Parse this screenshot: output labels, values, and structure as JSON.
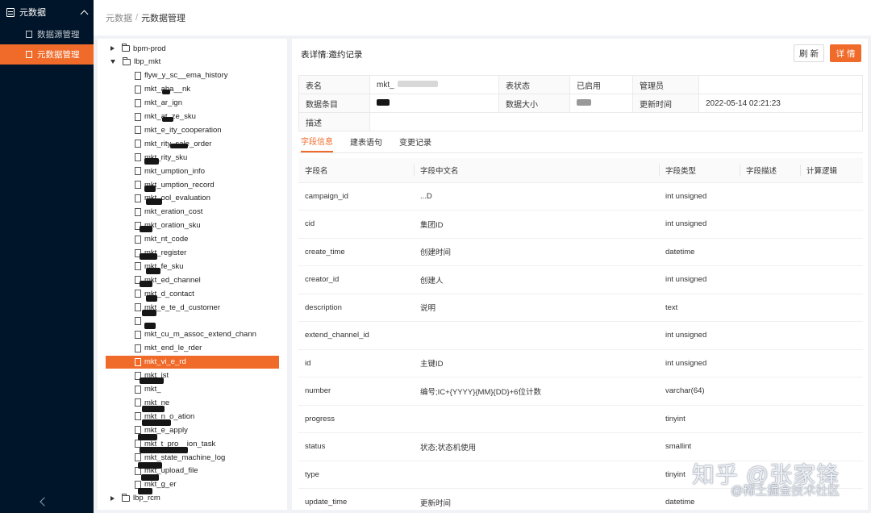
{
  "sidebar": {
    "group_label": "元数据",
    "items": [
      {
        "label": "数据源管理",
        "active": false
      },
      {
        "label": "元数据管理",
        "active": true
      }
    ]
  },
  "breadcrumb": {
    "parent": "元数据",
    "separator": "/",
    "current": "元数据管理"
  },
  "tree": {
    "nodes": [
      {
        "label": "bpm-prod",
        "kind": "folder",
        "expanded": false
      },
      {
        "label": "lbp_mkt",
        "kind": "folder",
        "expanded": true
      },
      {
        "label": "flyw_y_sc__ema_history",
        "kind": "file"
      },
      {
        "label": "mkt_aba__nk",
        "kind": "file"
      },
      {
        "label": "mkt_ar_ign",
        "kind": "file"
      },
      {
        "label": "mkt_at_ze_sku",
        "kind": "file"
      },
      {
        "label": "mkt_e_ity_cooperation",
        "kind": "file"
      },
      {
        "label": "mkt_rity_sale_order",
        "kind": "file"
      },
      {
        "label": "mkt_rity_sku",
        "kind": "file"
      },
      {
        "label": "mkt_umption_info",
        "kind": "file"
      },
      {
        "label": "mkt_umption_record",
        "kind": "file"
      },
      {
        "label": "mkt_ool_evaluation",
        "kind": "file"
      },
      {
        "label": "mkt_eration_cost",
        "kind": "file"
      },
      {
        "label": "mkt_oration_sku",
        "kind": "file"
      },
      {
        "label": "mkt_nt_code",
        "kind": "file"
      },
      {
        "label": "mkt_register",
        "kind": "file"
      },
      {
        "label": "mkt_fe_sku",
        "kind": "file"
      },
      {
        "label": "mkt_ed_channel",
        "kind": "file"
      },
      {
        "label": "mkt_d_contact",
        "kind": "file"
      },
      {
        "label": "mkt_e_te_d_customer",
        "kind": "file"
      },
      {
        "label": "",
        "kind": "file"
      },
      {
        "label": "mkt_cu_m_assoc_extend_chann",
        "kind": "file"
      },
      {
        "label": "mkt_end_le_rder",
        "kind": "file"
      },
      {
        "label": "mkt_vi_e_rd",
        "kind": "file",
        "selected": true
      },
      {
        "label": "mkt_ist",
        "kind": "file"
      },
      {
        "label": "mkt_",
        "kind": "file"
      },
      {
        "label": "mkt_ne",
        "kind": "file"
      },
      {
        "label": "mkt_n_o_ation",
        "kind": "file"
      },
      {
        "label": "mkt_e_apply",
        "kind": "file"
      },
      {
        "label": "mkt_t_pro__ion_task",
        "kind": "file"
      },
      {
        "label": "mkt_state_machine_log",
        "kind": "file"
      },
      {
        "label": "mkt_upload_file",
        "kind": "file"
      },
      {
        "label": "mkt_g_er",
        "kind": "file"
      },
      {
        "label": "lbp_rcm",
        "kind": "folder",
        "expanded": false
      }
    ]
  },
  "main": {
    "title": "表详情:邀约记录",
    "refresh_label": "刷 新",
    "detail_label": "详 情",
    "info": {
      "table_name_label": "表名",
      "table_name_value": "mkt_",
      "status_label": "表状态",
      "status_value": "已启用",
      "admin_label": "管理员",
      "admin_value": "",
      "rows_label": "数据条目",
      "rows_value": "",
      "size_label": "数据大小",
      "size_value": "",
      "updated_label": "更新时间",
      "updated_value": "2022-05-14 02:21:23",
      "desc_label": "描述",
      "desc_value": ""
    },
    "tabs": [
      {
        "label": "字段信息",
        "active": true
      },
      {
        "label": "建表语句",
        "active": false
      },
      {
        "label": "变更记录",
        "active": false
      }
    ],
    "columns": [
      "字段名",
      "字段中文名",
      "字段类型",
      "字段描述",
      "计算逻辑"
    ],
    "rows": [
      {
        "name": "campaign_id",
        "cn": "...D",
        "type": "int unsigned"
      },
      {
        "name": "cid",
        "cn": "集团ID",
        "type": "int unsigned"
      },
      {
        "name": "create_time",
        "cn": "创建时间",
        "type": "datetime"
      },
      {
        "name": "creator_id",
        "cn": "创建人",
        "type": "int unsigned"
      },
      {
        "name": "description",
        "cn": "说明",
        "type": "text"
      },
      {
        "name": "extend_channel_id",
        "cn": "",
        "type": "int unsigned"
      },
      {
        "name": "id",
        "cn": "主键ID",
        "type": "int unsigned"
      },
      {
        "name": "number",
        "cn": "编号;IC+{YYYY}{MM}{DD}+6位计数",
        "type": "varchar(64)"
      },
      {
        "name": "progress",
        "cn": "",
        "type": "tinyint"
      },
      {
        "name": "status",
        "cn": "状态;状态机使用",
        "type": "smallint"
      },
      {
        "name": "type",
        "cn": "",
        "type": "tinyint"
      },
      {
        "name": "update_time",
        "cn": "更新时间",
        "type": "datetime"
      }
    ]
  },
  "watermark": {
    "line1": "知乎 @张家锋",
    "line2": "@稀土掘金技术社区"
  },
  "colors": {
    "accent": "#f06b2a",
    "sidebar_bg": "#001529"
  }
}
